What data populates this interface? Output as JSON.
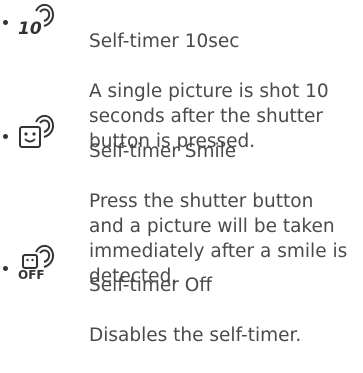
{
  "items": [
    {
      "icon": "self-timer-10sec-icon",
      "icon_label": "10",
      "title": "Self-timer 10sec",
      "description": "A single picture is shot 10\nseconds after the shutter\nbutton is pressed."
    },
    {
      "icon": "self-timer-smile-icon",
      "title": "Self-timer Smile",
      "description": "Press the shutter button\nand a picture will be taken\nimmediately after a smile is\ndetected."
    },
    {
      "icon": "self-timer-off-icon",
      "icon_label": "OFF",
      "title": "Self-timer Off",
      "description": "Disables the self-timer."
    }
  ]
}
